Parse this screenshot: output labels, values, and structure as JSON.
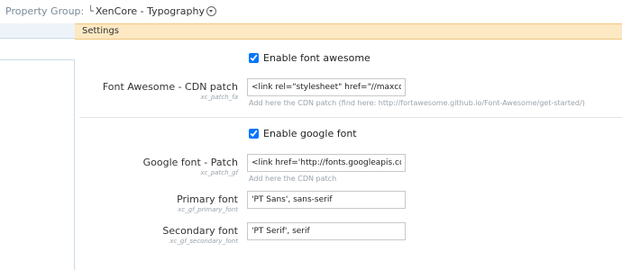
{
  "topbar": {
    "property_group_label": "Property Group:",
    "corner_glyph": "└",
    "property_group_value": "XenCore - Typography",
    "dropdown_icon": "chevron-down-circle-icon"
  },
  "settings_header": {
    "title": "Settings"
  },
  "font_awesome": {
    "enable_label": "Enable font awesome",
    "enabled": true,
    "cdn_label": "Font Awesome - CDN patch",
    "cdn_key": "xc_patch_fa",
    "cdn_value": "<link rel=\"stylesheet\" href=\"//maxcdn",
    "cdn_hint": "Add here the CDN patch (find here: http://fortawesome.github.io/Font-Awesome/get-started/)"
  },
  "google_font": {
    "enable_label": "Enable google font",
    "enabled": true,
    "patch_label": "Google font - Patch",
    "patch_key": "xc_patch_gf",
    "patch_value": "<link href='http://fonts.googleapis.com",
    "patch_hint": "Add here the CDN patch",
    "primary_label": "Primary font",
    "primary_key": "xc_gf_primary_font",
    "primary_value": "'PT Sans', sans-serif",
    "secondary_label": "Secondary font",
    "secondary_key": "xc_gf_secondary_font",
    "secondary_value": "'PT Serif', serif"
  },
  "colors": {
    "header_bg": "#fce8c2",
    "header_border": "#f0c77b",
    "sidebar_border": "#c9dbe9"
  }
}
